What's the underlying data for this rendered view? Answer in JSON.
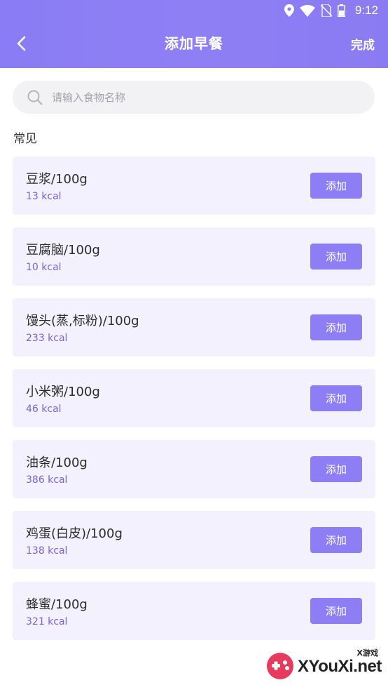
{
  "status_bar": {
    "time": "9:12"
  },
  "header": {
    "title": "添加早餐",
    "done_label": "完成"
  },
  "search": {
    "placeholder": "请输入食物名称"
  },
  "section": {
    "title": "常见"
  },
  "foods": [
    {
      "name": "豆浆/100g",
      "kcal": "13 kcal",
      "add_label": "添加"
    },
    {
      "name": "豆腐脑/100g",
      "kcal": "10 kcal",
      "add_label": "添加"
    },
    {
      "name": "馒头(蒸,标粉)/100g",
      "kcal": "233 kcal",
      "add_label": "添加"
    },
    {
      "name": "小米粥/100g",
      "kcal": "46 kcal",
      "add_label": "添加"
    },
    {
      "name": "油条/100g",
      "kcal": "386 kcal",
      "add_label": "添加"
    },
    {
      "name": "鸡蛋(白皮)/100g",
      "kcal": "138 kcal",
      "add_label": "添加"
    },
    {
      "name": "蜂蜜/100g",
      "kcal": "321 kcal",
      "add_label": "添加"
    }
  ],
  "watermark": {
    "text": "XYouXi.net",
    "small": "X游戏"
  },
  "colors": {
    "accent": "#8d7ef5",
    "kcal": "#7565d8",
    "card": "#f3f1fd"
  },
  "icons": [
    "location-icon",
    "wifi-icon",
    "no-sim-icon",
    "battery-icon",
    "back-arrow-icon",
    "search-icon"
  ]
}
